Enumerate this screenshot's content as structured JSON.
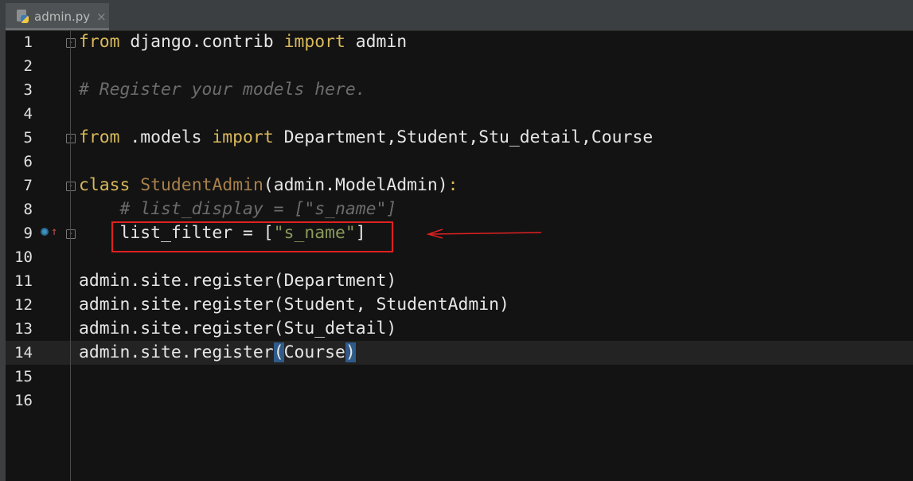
{
  "tab": {
    "title": "admin.py",
    "close": "×"
  },
  "colors": {
    "keyword": "#d8b85c",
    "class_name": "#a8804a",
    "comment": "#6c6c6c",
    "string": "#8a9a5b",
    "annotation": "#e02020"
  },
  "lines": [
    {
      "n": "1",
      "tokens": [
        [
          "from",
          "kw"
        ],
        [
          " django.contrib ",
          ""
        ],
        [
          "import",
          "kw"
        ],
        [
          " admin",
          ""
        ]
      ]
    },
    {
      "n": "2",
      "tokens": []
    },
    {
      "n": "3",
      "tokens": [
        [
          "# Register your models here.",
          "cm"
        ]
      ]
    },
    {
      "n": "4",
      "tokens": []
    },
    {
      "n": "5",
      "tokens": [
        [
          "from",
          "kw"
        ],
        [
          " .models ",
          ""
        ],
        [
          "import",
          "kw"
        ],
        [
          " Department,Student,Stu_detail,Course",
          ""
        ]
      ]
    },
    {
      "n": "6",
      "tokens": []
    },
    {
      "n": "7",
      "tokens": [
        [
          "class",
          "kw"
        ],
        [
          " ",
          ""
        ],
        [
          "StudentAdmin",
          "cls"
        ],
        [
          "(admin.ModelAdmin)",
          ""
        ],
        [
          ":",
          "kw"
        ]
      ]
    },
    {
      "n": "8",
      "tokens": [
        [
          "    # list_display = [\"s_name\"]",
          "cm"
        ]
      ]
    },
    {
      "n": "9",
      "tokens": [
        [
          "    list_filter = [",
          ""
        ],
        [
          "\"s_name\"",
          "str"
        ],
        [
          "]",
          ""
        ]
      ]
    },
    {
      "n": "10",
      "tokens": []
    },
    {
      "n": "11",
      "tokens": [
        [
          "admin.site.register(Department)",
          ""
        ]
      ]
    },
    {
      "n": "12",
      "tokens": [
        [
          "admin.site.register(Student, StudentAdmin)",
          ""
        ]
      ]
    },
    {
      "n": "13",
      "tokens": [
        [
          "admin.site.register(Stu_detail)",
          ""
        ]
      ]
    },
    {
      "n": "14",
      "tokens": [
        [
          "admin.site.register",
          ""
        ],
        [
          "(",
          "br"
        ],
        [
          "Course",
          ""
        ],
        [
          ")",
          "br"
        ]
      ]
    },
    {
      "n": "15",
      "tokens": []
    },
    {
      "n": "16",
      "tokens": []
    }
  ],
  "current_line": "14"
}
